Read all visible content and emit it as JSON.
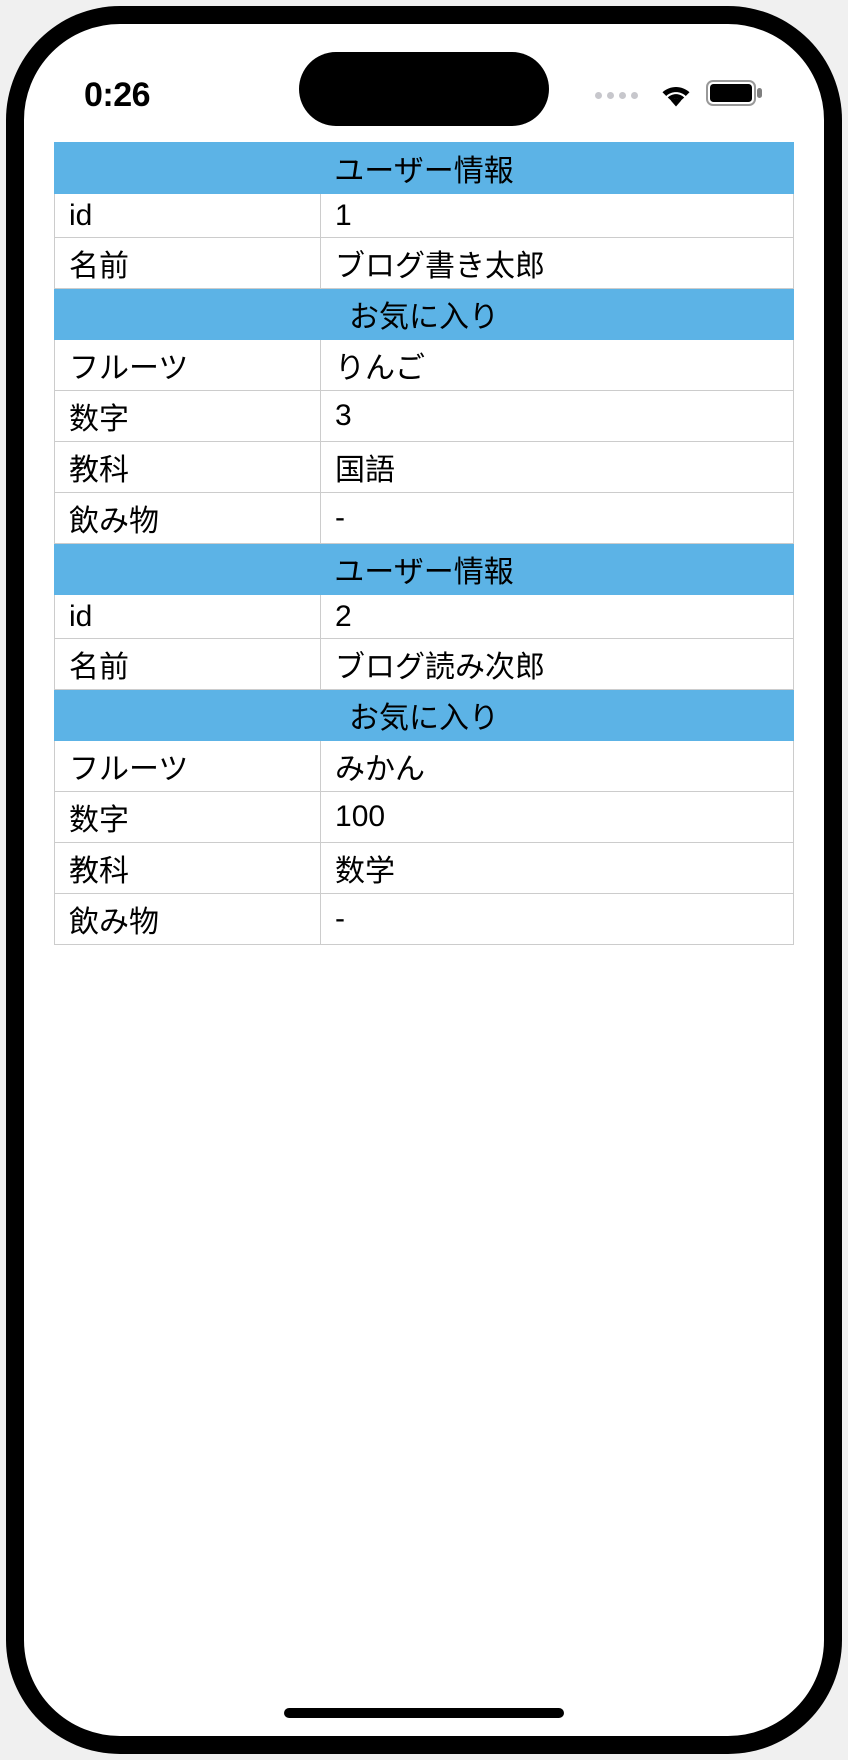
{
  "status": {
    "time": "0:26"
  },
  "sections": [
    {
      "header": "ユーザー情報",
      "rows": [
        {
          "label": "id",
          "value": "1"
        },
        {
          "label": "名前",
          "value": "ブログ書き太郎"
        }
      ]
    },
    {
      "header": "お気に入り",
      "rows": [
        {
          "label": "フルーツ",
          "value": "りんご"
        },
        {
          "label": "数字",
          "value": "3"
        },
        {
          "label": "教科",
          "value": "国語"
        },
        {
          "label": "飲み物",
          "value": "-"
        }
      ]
    },
    {
      "header": "ユーザー情報",
      "rows": [
        {
          "label": "id",
          "value": "2"
        },
        {
          "label": "名前",
          "value": "ブログ読み次郎"
        }
      ]
    },
    {
      "header": "お気に入り",
      "rows": [
        {
          "label": "フルーツ",
          "value": "みかん"
        },
        {
          "label": "数字",
          "value": "100"
        },
        {
          "label": "教科",
          "value": "数学"
        },
        {
          "label": "飲み物",
          "value": "-"
        }
      ]
    }
  ]
}
